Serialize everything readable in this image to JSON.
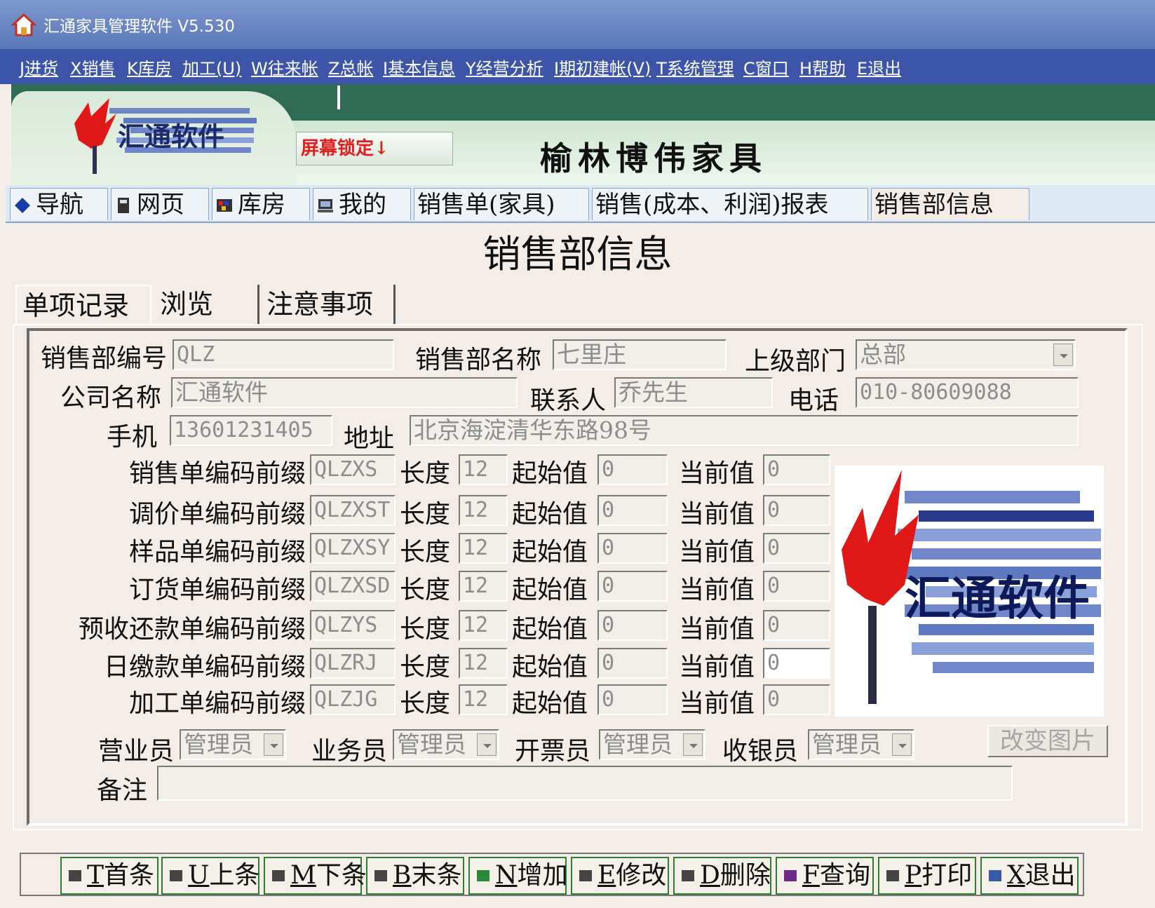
{
  "window": {
    "title": "汇通家具管理软件 V5.530"
  },
  "menu": [
    {
      "label": "J进货"
    },
    {
      "label": "X销售"
    },
    {
      "label": "K库房"
    },
    {
      "label": "加工(U)"
    },
    {
      "label": "W往来帐"
    },
    {
      "label": "Z总帐"
    },
    {
      "label": "I基本信息"
    },
    {
      "label": "Y经营分析"
    },
    {
      "label": "I期初建帐(V)"
    },
    {
      "label": "T系统管理"
    },
    {
      "label": "C窗口"
    },
    {
      "label": "H帮助"
    },
    {
      "label": "E退出"
    }
  ],
  "banner": {
    "logo_text": "汇通软件",
    "lock_button": "屏幕锁定↓",
    "company": "榆林博伟家具"
  },
  "page_tabs": [
    {
      "label": "导航"
    },
    {
      "label": "网页"
    },
    {
      "label": "库房"
    },
    {
      "label": "我的"
    },
    {
      "label": "销售单(家具)"
    },
    {
      "label": "销售(成本、利润)报表"
    },
    {
      "label": "销售部信息"
    }
  ],
  "page_title": "销售部信息",
  "inner_tabs": [
    {
      "label": "单项记录"
    },
    {
      "label": "浏览"
    },
    {
      "label": "注意事项"
    }
  ],
  "form": {
    "dept_code": {
      "label": "销售部编号",
      "value": "QLZ"
    },
    "dept_name": {
      "label": "销售部名称",
      "value": "七里庄"
    },
    "parent_dept": {
      "label": "上级部门",
      "value": "总部"
    },
    "company": {
      "label": "公司名称",
      "value": "汇通软件"
    },
    "contact": {
      "label": "联系人",
      "value": "乔先生"
    },
    "phone": {
      "label": "电话",
      "value": "010-80609088"
    },
    "mobile": {
      "label": "手机",
      "value": "13601231405"
    },
    "address": {
      "label": "地址",
      "value": "北京海淀清华东路98号"
    },
    "col_length": "长度",
    "col_start": "起始值",
    "col_current": "当前值",
    "prefix_rows": [
      {
        "label": "销售单编码前缀",
        "prefix": "QLZXS",
        "length": "12",
        "start": "0",
        "current": "0"
      },
      {
        "label": "调价单编码前缀",
        "prefix": "QLZXST",
        "length": "12",
        "start": "0",
        "current": "0"
      },
      {
        "label": "样品单编码前缀",
        "prefix": "QLZXSY",
        "length": "12",
        "start": "0",
        "current": "0"
      },
      {
        "label": "订货单编码前缀",
        "prefix": "QLZXSD",
        "length": "12",
        "start": "0",
        "current": "0"
      },
      {
        "label": "预收还款单编码前缀",
        "prefix": "QLZYS",
        "length": "12",
        "start": "0",
        "current": "0"
      },
      {
        "label": "日缴款单编码前缀",
        "prefix": "QLZRJ",
        "length": "12",
        "start": "0",
        "current": "0"
      },
      {
        "label": "加工单编码前缀",
        "prefix": "QLZJG",
        "length": "12",
        "start": "0",
        "current": "0"
      }
    ],
    "salesclerk": {
      "label": "营业员",
      "value": "管理员"
    },
    "salesman": {
      "label": "业务员",
      "value": "管理员"
    },
    "invoicer": {
      "label": "开票员",
      "value": "管理员"
    },
    "cashier": {
      "label": "收银员",
      "value": "管理员"
    },
    "remark": {
      "label": "备注",
      "value": ""
    },
    "change_picture": "改变图片",
    "picture_text": "汇通软件"
  },
  "toolbar": [
    {
      "key": "T",
      "label": "首条",
      "icon": "first-icon"
    },
    {
      "key": "U",
      "label": "上条",
      "icon": "prev-icon"
    },
    {
      "key": "M",
      "label": "下条",
      "icon": "next-icon"
    },
    {
      "key": "B",
      "label": "末条",
      "icon": "last-icon"
    },
    {
      "key": "N",
      "label": "增加",
      "icon": "add-icon"
    },
    {
      "key": "E",
      "label": "修改",
      "icon": "edit-icon"
    },
    {
      "key": "D",
      "label": "删除",
      "icon": "delete-icon"
    },
    {
      "key": "F",
      "label": "查询",
      "icon": "search-icon"
    },
    {
      "key": "P",
      "label": "打印",
      "icon": "print-icon"
    },
    {
      "key": "X",
      "label": "退出",
      "icon": "exit-icon"
    }
  ],
  "colors": {
    "menu_bg": "#3c55a8",
    "title_bg": "#6c87c4",
    "accent_green": "#2f7d32",
    "lock_red": "#e02020"
  }
}
